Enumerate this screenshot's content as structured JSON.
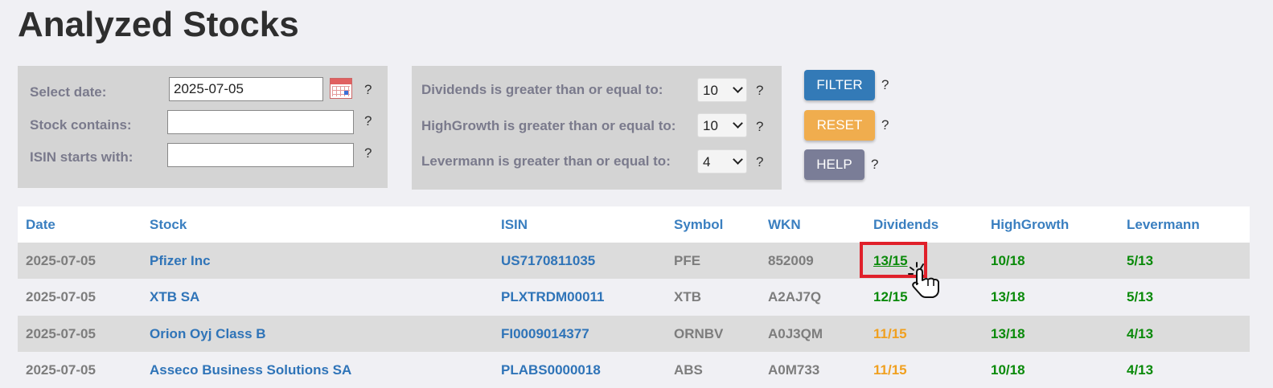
{
  "page": {
    "title": "Analyzed Stocks"
  },
  "filters_left": {
    "date_label": "Select date:",
    "date_value": "2025-07-05",
    "stock_label": "Stock contains:",
    "stock_value": "",
    "isin_label": "ISIN starts with:",
    "isin_value": "",
    "help_mark": "?"
  },
  "filters_mid": {
    "dividends_label": "Dividends is greater than or equal to:",
    "dividends_value": "10",
    "highgrowth_label": "HighGrowth is greater than or equal to:",
    "highgrowth_value": "10",
    "levermann_label": "Levermann is greater than or equal to:",
    "levermann_value": "4",
    "help_mark": "?"
  },
  "buttons": {
    "filter_label": "FILTER",
    "reset_label": "RESET",
    "help_label": "HELP",
    "help_mark": "?"
  },
  "table": {
    "headers": [
      "Date",
      "Stock",
      "ISIN",
      "Symbol",
      "WKN",
      "Dividends",
      "HighGrowth",
      "Levermann"
    ],
    "rows": [
      {
        "date": "2025-07-05",
        "stock": "Pfizer Inc",
        "isin": "US7170811035",
        "symbol": "PFE",
        "wkn": "852009",
        "dividends": "13/15",
        "highgrowth": "10/18",
        "levermann": "5/13"
      },
      {
        "date": "2025-07-05",
        "stock": "XTB SA",
        "isin": "PLXTRDM00011",
        "symbol": "XTB",
        "wkn": "A2AJ7Q",
        "dividends": "12/15",
        "highgrowth": "13/18",
        "levermann": "5/13"
      },
      {
        "date": "2025-07-05",
        "stock": "Orion Oyj Class B",
        "isin": "FI0009014377",
        "symbol": "ORNBV",
        "wkn": "A0J3QM",
        "dividends": "11/15",
        "highgrowth": "13/18",
        "levermann": "4/13"
      },
      {
        "date": "2025-07-05",
        "stock": "Asseco Business Solutions SA",
        "isin": "PLABS0000018",
        "symbol": "ABS",
        "wkn": "A0M733",
        "dividends": "11/15",
        "highgrowth": "10/18",
        "levermann": "4/13"
      }
    ]
  },
  "colors": {
    "link_blue": "#2f74b8",
    "score_green": "#0a8a0a",
    "score_orange": "#f0a020",
    "filter_button": "#337ab7",
    "reset_button": "#f0ad4e",
    "help_button": "#7a7d97",
    "row_alt": "#dcdcdc",
    "highlight_red": "#e0202a"
  }
}
